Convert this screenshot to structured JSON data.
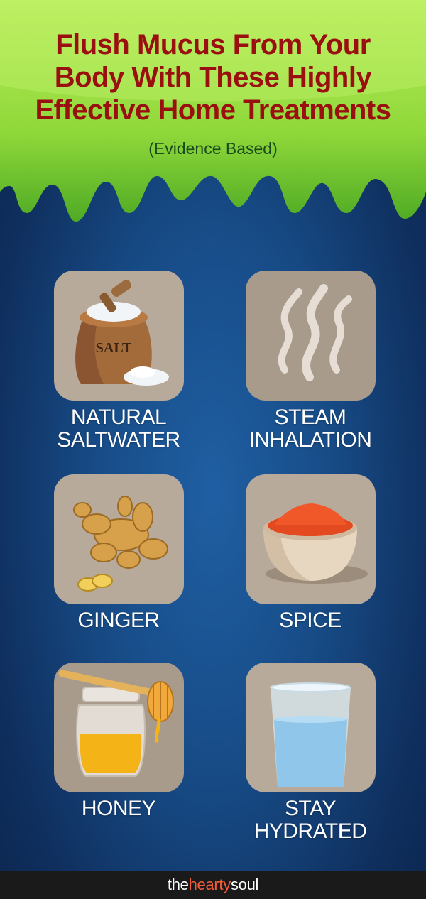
{
  "title": {
    "line1": "Flush Mucus From Your",
    "line2": "Body With These Highly",
    "line3": "Effective Home Treatments"
  },
  "subtitle": "(Evidence Based)",
  "treatments": [
    {
      "line1": "NATURAL",
      "line2": "SALTWATER",
      "icon": "salt-sack-icon"
    },
    {
      "line1": "STEAM",
      "line2": "INHALATION",
      "icon": "steam-icon"
    },
    {
      "line1": "GINGER",
      "icon": "ginger-root-icon"
    },
    {
      "line1": "SPICE",
      "icon": "spice-bowl-icon"
    },
    {
      "line1": "HONEY",
      "icon": "honey-jar-icon"
    },
    {
      "line1": "STAY",
      "line2": "HYDRATED",
      "icon": "water-glass-icon"
    }
  ],
  "salt_sack_label": "SALT",
  "footer": {
    "brand_start": "the",
    "brand_mid": "hearty",
    "brand_end": "soul"
  },
  "colors": {
    "title": "#9a1010",
    "slime": "#8ed934",
    "background": "#174b86",
    "card": "#b7aa9a",
    "brand_accent": "#f25c3b"
  }
}
